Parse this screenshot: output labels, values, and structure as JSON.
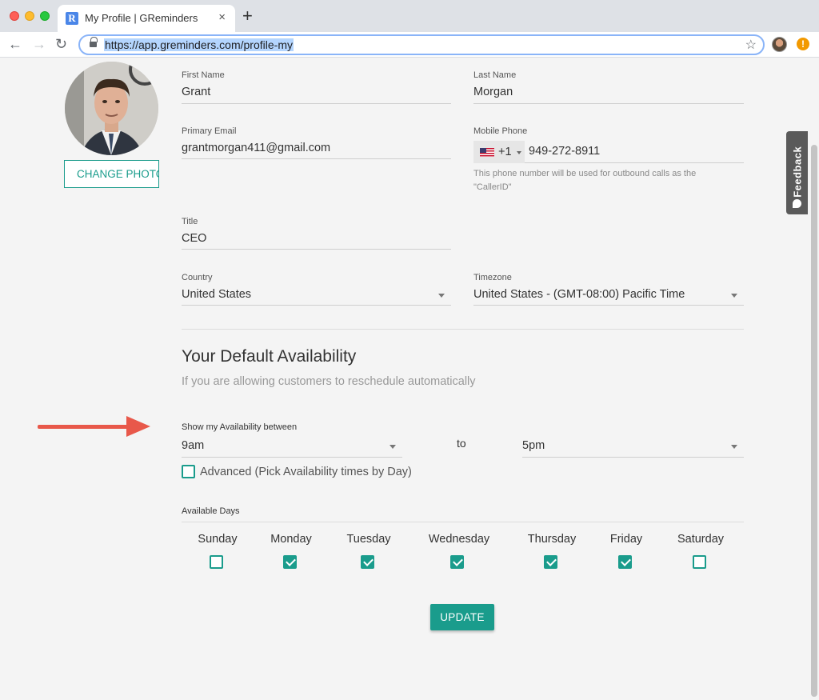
{
  "browser": {
    "tab_title": "My Profile | GReminders",
    "favicon_letter": "R",
    "tab_close": "×",
    "new_tab": "+",
    "url": "https://app.greminders.com/profile-my",
    "alert_glyph": "!"
  },
  "feedback": {
    "label": "Feedback"
  },
  "profile": {
    "change_photo_label": "CHANGE PHOTO",
    "first_name": {
      "label": "First Name",
      "value": "Grant"
    },
    "last_name": {
      "label": "Last Name",
      "value": "Morgan"
    },
    "primary_email": {
      "label": "Primary Email",
      "value": "grantmorgan411@gmail.com"
    },
    "mobile_phone": {
      "label": "Mobile Phone",
      "country_flag": "us-flag-icon",
      "dial_code": "+1",
      "value": "949-272-8911",
      "helper_line1": "This phone number will be used for outbound calls as the",
      "helper_line2": "\"CallerID\""
    },
    "title": {
      "label": "Title",
      "value": "CEO"
    },
    "country": {
      "label": "Country",
      "value": "United States"
    },
    "timezone": {
      "label": "Timezone",
      "value": "United States - (GMT-08:00) Pacific Time"
    }
  },
  "availability": {
    "heading": "Your Default Availability",
    "subheading": "If you are allowing customers to reschedule automatically",
    "between_label": "Show my Availability between",
    "start": "9am",
    "to_label": "to",
    "end": "5pm",
    "advanced_label": "Advanced (Pick Availability times by Day)",
    "advanced_checked": false,
    "available_days_label": "Available Days",
    "days": [
      {
        "name": "Sunday",
        "checked": false
      },
      {
        "name": "Monday",
        "checked": true
      },
      {
        "name": "Tuesday",
        "checked": true
      },
      {
        "name": "Wednesday",
        "checked": true
      },
      {
        "name": "Thursday",
        "checked": true
      },
      {
        "name": "Friday",
        "checked": true
      },
      {
        "name": "Saturday",
        "checked": false
      }
    ]
  },
  "actions": {
    "update_label": "UPDATE"
  },
  "colors": {
    "accent": "#1a9c8c",
    "annotation_arrow": "#e8584a"
  }
}
